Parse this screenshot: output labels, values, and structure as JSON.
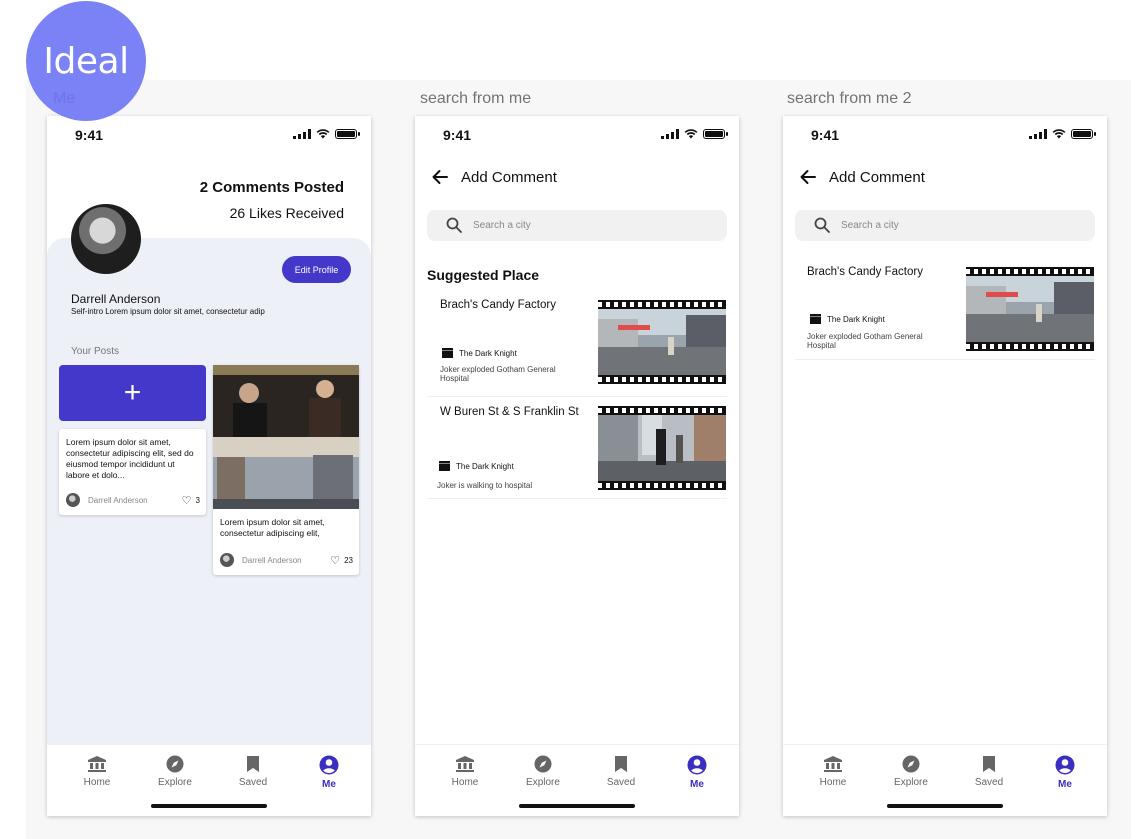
{
  "badge": {
    "text": "Ideal"
  },
  "frames": {
    "me_label": "Me",
    "search1_label": "search from me",
    "search2_label": "search from me 2"
  },
  "status": {
    "time": "9:41"
  },
  "profile": {
    "comments_posted": "2 Comments Posted",
    "likes_received": "26 Likes Received",
    "edit_label": "Edit Profile",
    "name": "Darrell Anderson",
    "intro": "Self-intro Lorem ipsum dolor sit amet, consectetur adip",
    "your_posts": "Your Posts",
    "add_symbol": "+",
    "posts": [
      {
        "text": "Lorem ipsum dolor sit amet, consectetur adipiscing elit, sed do eiusmod tempor incididunt ut labore et dolo...",
        "author": "Darrell Anderson",
        "likes": "3"
      },
      {
        "text": "Lorem ipsum dolor sit amet, consectetur adipiscing elit,",
        "author": "Darrell Anderson",
        "likes": "23"
      }
    ]
  },
  "add_comment": {
    "title": "Add Comment",
    "search_placeholder": "Search a city",
    "suggested_heading": "Suggested Place",
    "places": [
      {
        "name": "Brach's Candy Factory",
        "movie": "The Dark Knight",
        "desc": "Joker exploded Gotham General Hospital"
      },
      {
        "name": "W Buren St & S Franklin St",
        "movie": "The Dark Knight",
        "desc": "Joker is walking to hospital"
      }
    ]
  },
  "nav": {
    "items": [
      {
        "label": "Home",
        "icon": "bank-icon"
      },
      {
        "label": "Explore",
        "icon": "compass-icon"
      },
      {
        "label": "Saved",
        "icon": "bookmark-icon"
      },
      {
        "label": "Me",
        "icon": "account-icon"
      }
    ],
    "active": "Me",
    "active_color": "#3b2fbf"
  },
  "colors": {
    "accent": "#4338c9",
    "badge": "#7b82f5",
    "profile_bg": "#eef0f8"
  }
}
